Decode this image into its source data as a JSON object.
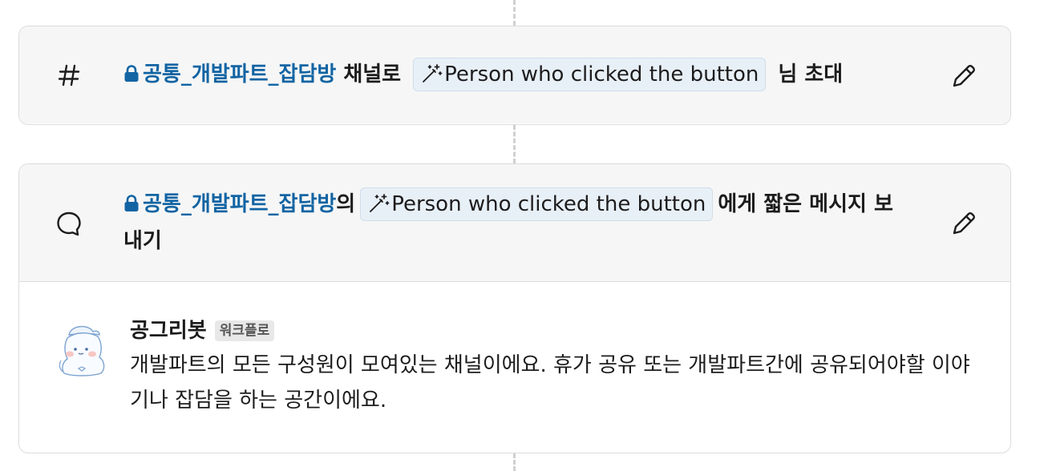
{
  "steps": [
    {
      "icon": "hash-icon",
      "channel": "공통_개발파트_잡담방",
      "before_var": "채널로",
      "variable": "Person who clicked the button",
      "after_var": "님 초대"
    },
    {
      "icon": "speech-bubble-icon",
      "channel": "공통_개발파트_잡담방",
      "before_var": "의",
      "variable": "Person who clicked the button",
      "after_var": "에게 짧은 메시지 보내기"
    }
  ],
  "message_preview": {
    "sender": "공그리봇",
    "badge": "워크플로",
    "text": "개발파트의 모든 구성원이 모여있는 채널이에요. 휴가 공유 또는 개발파트간에 공유되어야할 이야기나 잡담을 하는 공간이에요."
  },
  "colors": {
    "link": "#1264a3",
    "pill_bg": "#e8f0f7",
    "header_bg": "#f6f6f6",
    "border": "#dcdcdc"
  }
}
